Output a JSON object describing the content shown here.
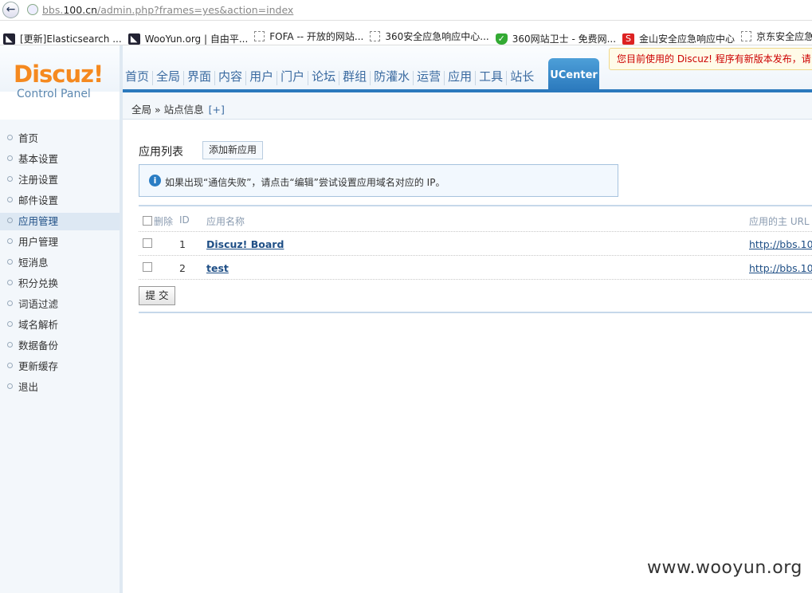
{
  "browser": {
    "url_prefix": "bbs.",
    "url_host": "100.cn",
    "url_path": "/admin.php?frames=yes&action=index"
  },
  "bookmarks": [
    {
      "label": "[更新]Elasticsearch ...",
      "icon": "dark"
    },
    {
      "label": "WooYun.org | 自由平...",
      "icon": "dark"
    },
    {
      "label": "FOFA -- 开放的网站...",
      "icon": "dash"
    },
    {
      "label": "360安全应急响应中心...",
      "icon": "dash"
    },
    {
      "label": "360网站卫士 - 免费网...",
      "icon": "shield"
    },
    {
      "label": "金山安全应急响应中心",
      "icon": "red"
    },
    {
      "label": "京东安全应急",
      "icon": "dash"
    }
  ],
  "header": {
    "logo": "Discuz!",
    "logo_sub": "Control Panel",
    "notice": "您目前使用的 Discuz! 程序有新版本发布，请",
    "nav": [
      "首页",
      "全局",
      "界面",
      "内容",
      "用户",
      "门户",
      "论坛",
      "群组",
      "防灌水",
      "运营",
      "应用",
      "工具",
      "站长"
    ],
    "nav_active": "UCenter"
  },
  "breadcrumb": {
    "path": "全局 » 站点信息",
    "plus": "[+]"
  },
  "sidebar": {
    "items": [
      "首页",
      "基本设置",
      "注册设置",
      "邮件设置",
      "应用管理",
      "用户管理",
      "短消息",
      "积分兑换",
      "词语过滤",
      "域名解析",
      "数据备份",
      "更新缓存",
      "退出"
    ],
    "active_index": 4
  },
  "main": {
    "title": "应用列表",
    "add_button": "添加新应用",
    "tip": "如果出现“通信失败”，请点击“编辑”尝试设置应用域名对应的 IP。",
    "table": {
      "headers": {
        "delete": "删除",
        "id": "ID",
        "name": "应用名称",
        "url": "应用的主 URL"
      },
      "rows": [
        {
          "id": "1",
          "name": "Discuz! Board",
          "url": "http://bbs.10"
        },
        {
          "id": "2",
          "name": "test",
          "url": "http://bbs.10"
        }
      ]
    },
    "submit": "提 交"
  },
  "watermark": "www.wooyun.org",
  "colors": {
    "accent": "#2b79bd",
    "logo": "#f5891f",
    "link": "#1f4f86",
    "notice": "#cc0000"
  }
}
